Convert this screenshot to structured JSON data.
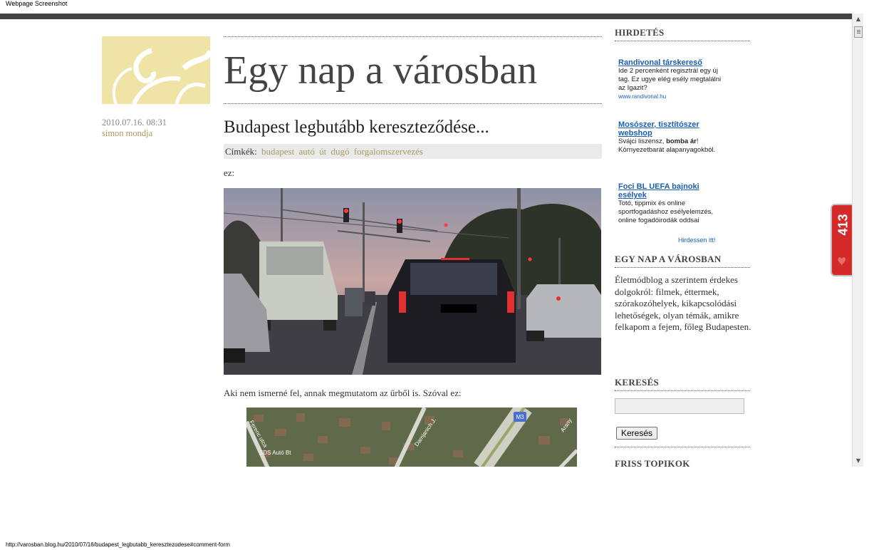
{
  "window": {
    "caption": "Webpage Screenshot"
  },
  "post": {
    "date": "2010.07.16. 08:31",
    "author": "simon mondja",
    "title": "Budapest legbutább kereszteződése...",
    "tags_label": "Címkék:",
    "tags": [
      "budapest",
      "autó",
      "út",
      "dugó",
      "forgalomszervezés"
    ],
    "intro": "ez:",
    "para2": "Aki nem ismerné fel, annak megmutatom az űrből is. Szóval ez:",
    "map_labels": {
      "street1": "Ferenc utca",
      "business": "SDS Autó Bt",
      "street2": "Damjanich J.",
      "road": "M3",
      "street3": "Arany"
    }
  },
  "site": {
    "title": "Egy nap a városban"
  },
  "sidebar": {
    "ads_heading": "HIRDETÉS",
    "ads": [
      {
        "title": "Randivonal társkereső",
        "text": "Ide 2 percenként regisztrál egy új tag. Ez ugye elég esély megtalálni az Igazit?",
        "url": "www.randivonal.hu"
      },
      {
        "title": "Mosószer, tisztítószer webshop",
        "text_pre": "Svájci liszensz, ",
        "text_bold": "bomba ár",
        "text_post": "! Környezetbarát alapanyagokból."
      },
      {
        "title": "Foci BL UEFA bajnoki esélyek",
        "text": "Totó, tippmix és online sportfogadáshoz esélyelemzés, online fogadóirodák oddsai"
      }
    ],
    "advertise_link": "Hirdessen itt!",
    "about_heading": "EGY NAP A VÁROSBAN",
    "about_text": "Életmódblog a szerintem érdekes dolgokról: filmek, éttermek, szórakozóhelyek, kikapcsolódási lehetőségek, olyan témák, amikre felkapom a fejem, főleg Budapesten.",
    "search_heading": "KERESÉS",
    "search_value": "",
    "search_button": "Keresés",
    "recent_heading": "FRISS TOPIKOK"
  },
  "widget": {
    "count": "413",
    "icon": "heart-icon"
  },
  "status_bar": {
    "url": "http://varosban.blog.hu/2010/07/16/budapest_legbutabb_keresztezodese#comment-form"
  },
  "colors": {
    "accent": "#a89a5e",
    "logo_bg": "#efe3a6",
    "link": "#1a5fb4",
    "widget": "#d42a2a"
  }
}
